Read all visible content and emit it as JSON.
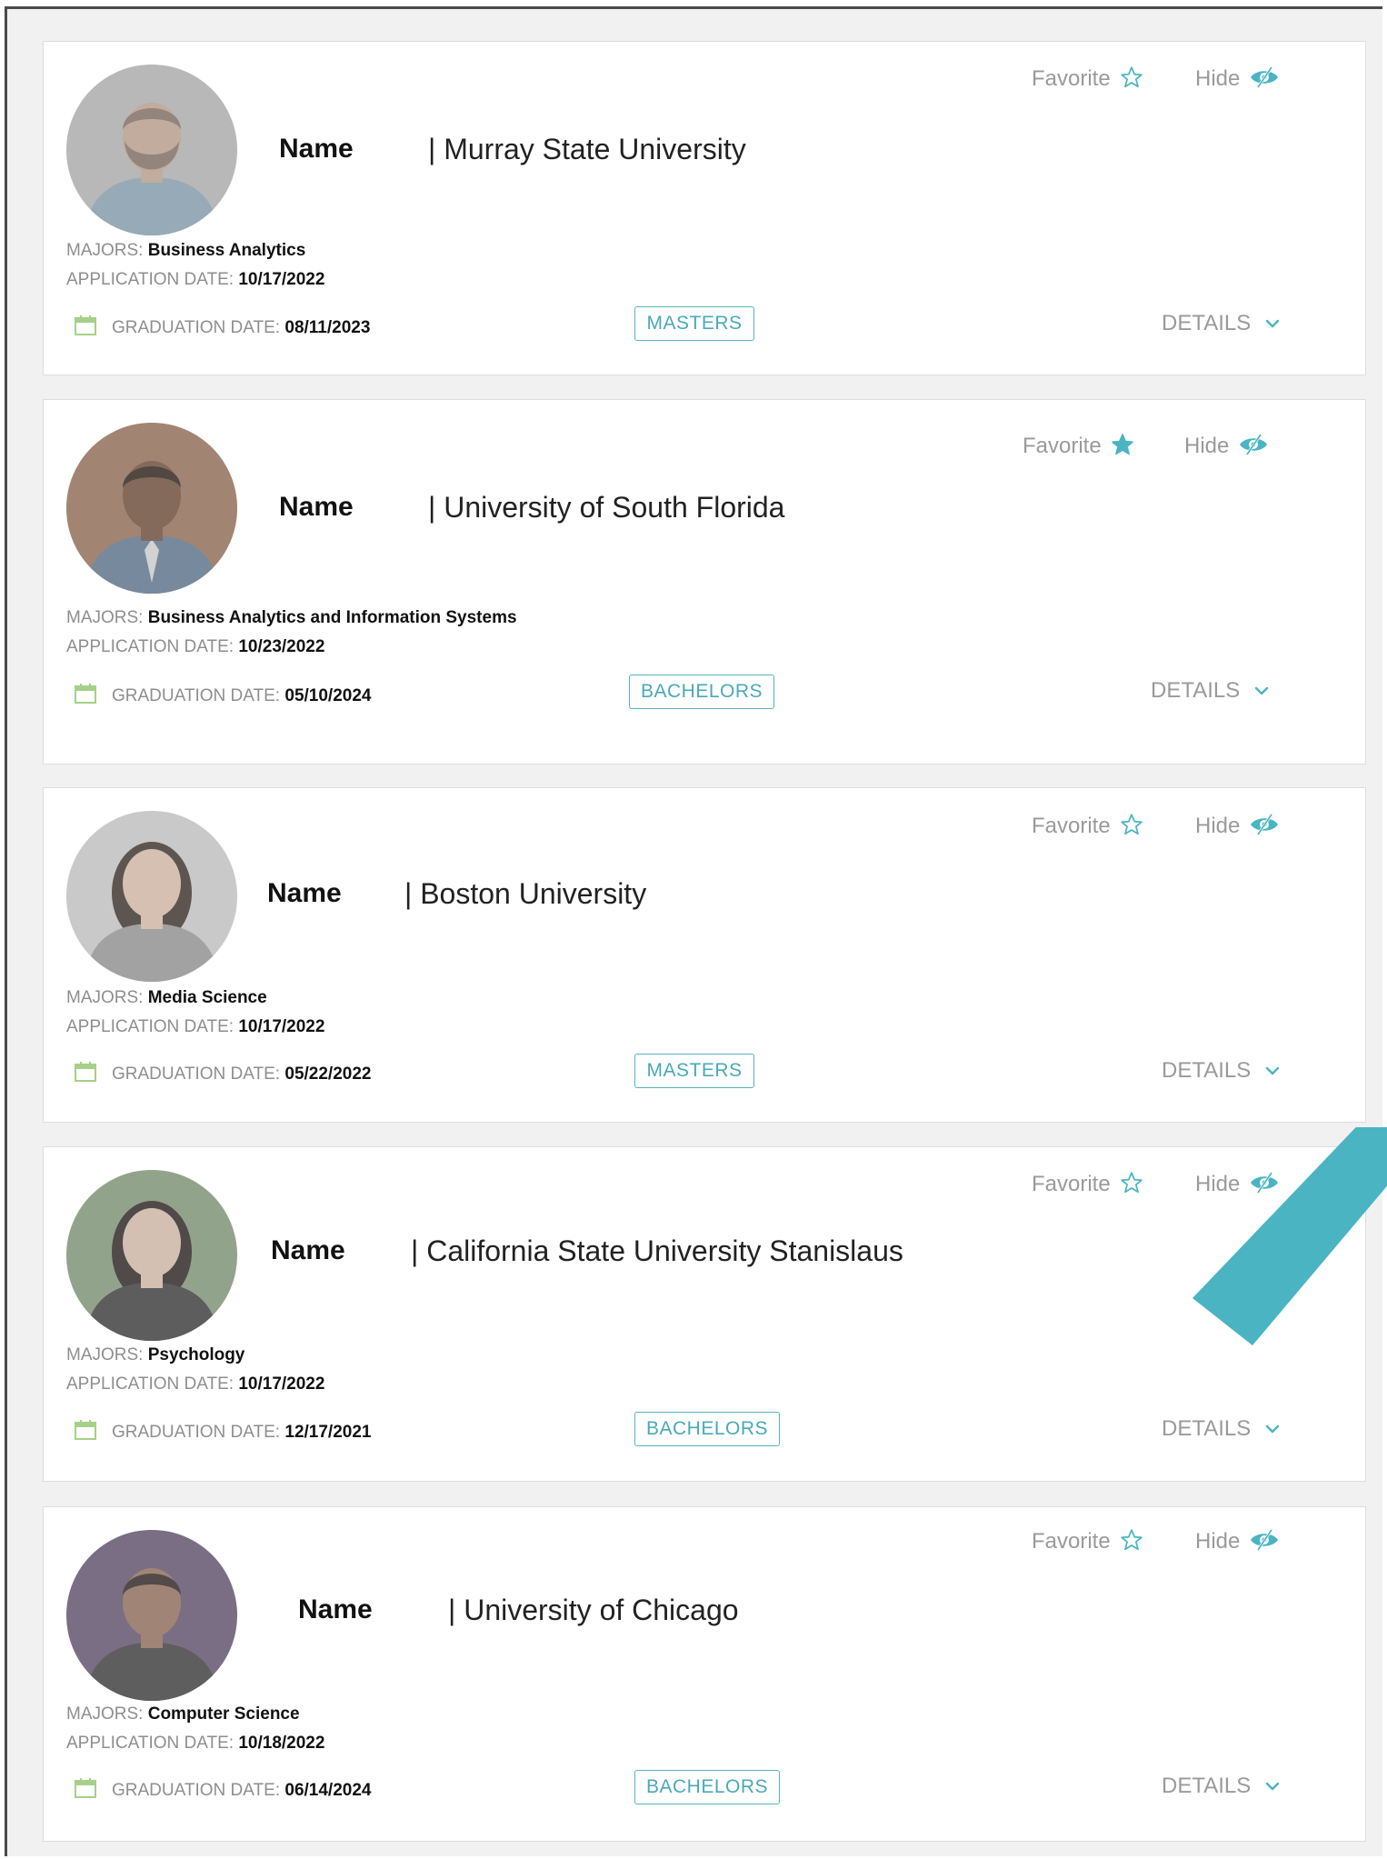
{
  "labels": {
    "majors": "MAJORS:",
    "application_date": "APPLICATION DATE:",
    "graduation_date": "GRADUATION DATE:",
    "favorite": "Favorite",
    "hide": "Hide",
    "details": "DETAILS"
  },
  "colors": {
    "accent": "#4ab4c3",
    "muted_text": "#9a9a9a",
    "calendar_icon": "#a6d08a"
  },
  "students": [
    {
      "name": "Name",
      "university": "| Murray State University",
      "majors": "Business Analytics",
      "application_date": "10/17/2022",
      "graduation_date": "08/11/2023",
      "degree": "MASTERS",
      "favorited": false
    },
    {
      "name": "Name",
      "university": "| University of South Florida",
      "majors": "Business Analytics and Information Systems",
      "application_date": "10/23/2022",
      "graduation_date": "05/10/2024",
      "degree": "BACHELORS",
      "favorited": true
    },
    {
      "name": "Name",
      "university": "| Boston University",
      "majors": "Media Science",
      "application_date": "10/17/2022",
      "graduation_date": "05/22/2022",
      "degree": "MASTERS",
      "favorited": false
    },
    {
      "name": "Name",
      "university": "| California State University Stanislaus",
      "majors": "Psychology",
      "application_date": "10/17/2022",
      "graduation_date": "12/17/2021",
      "degree": "BACHELORS",
      "favorited": false
    },
    {
      "name": "Name",
      "university": "| University of Chicago",
      "majors": "Computer Science",
      "application_date": "10/18/2022",
      "graduation_date": "06/14/2024",
      "degree": "BACHELORS",
      "favorited": false
    }
  ]
}
